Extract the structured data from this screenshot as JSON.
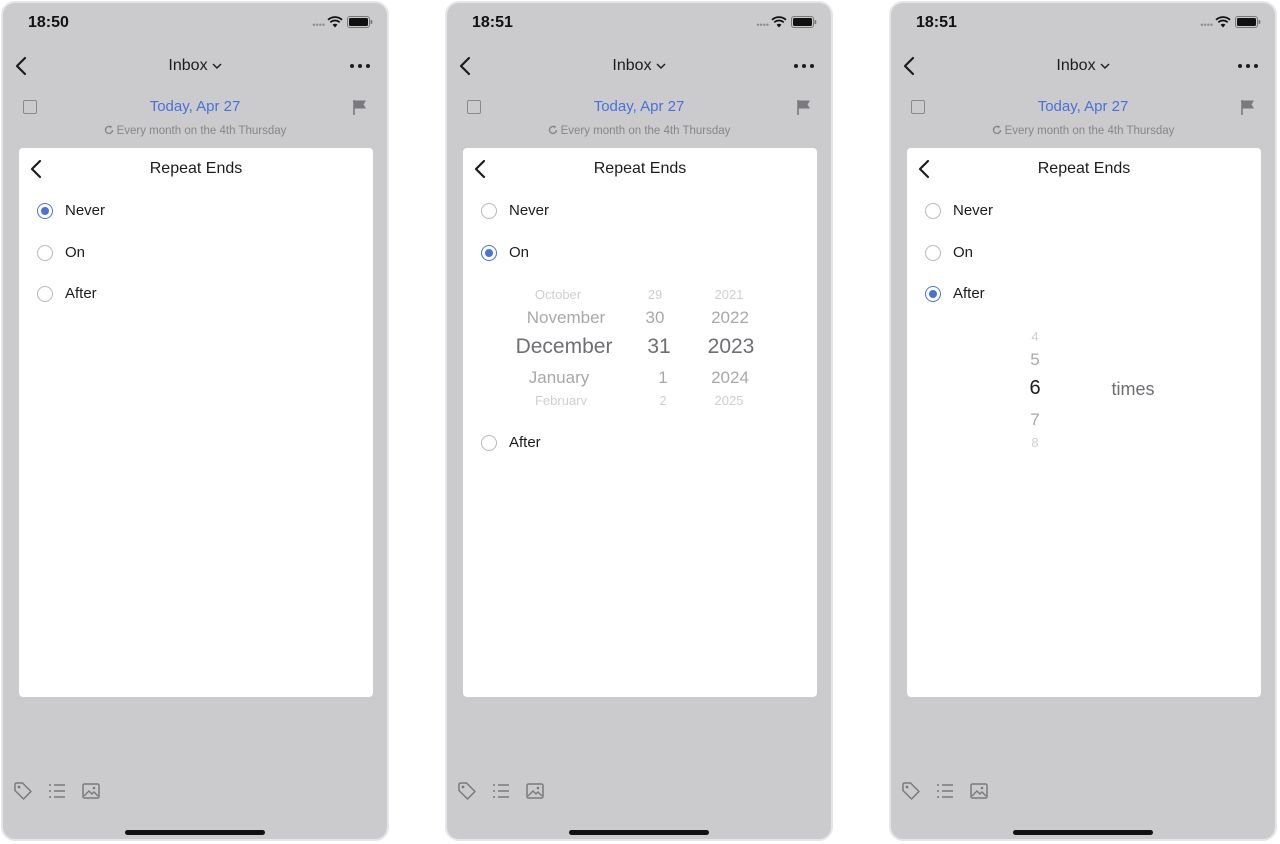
{
  "colors": {
    "accent": "#4a72d9",
    "date_link": "#4772db",
    "screen_bg": "#cbcbcd"
  },
  "screens": [
    {
      "status": {
        "time": "18:50",
        "signal": "••••"
      },
      "nav": {
        "title": "Inbox"
      },
      "task": {
        "date": "Today, Apr 27",
        "repeat": "Every month on the 4th Thursday"
      },
      "panel": {
        "title": "Repeat Ends",
        "options": [
          {
            "label": "Never",
            "selected": true
          },
          {
            "label": "On",
            "selected": false
          },
          {
            "label": "After",
            "selected": false
          }
        ]
      }
    },
    {
      "status": {
        "time": "18:51",
        "signal": "••••"
      },
      "nav": {
        "title": "Inbox"
      },
      "task": {
        "date": "Today, Apr 27",
        "repeat": "Every month on the 4th Thursday"
      },
      "panel": {
        "title": "Repeat Ends",
        "options": [
          {
            "label": "Never",
            "selected": false
          },
          {
            "label": "On",
            "selected": true
          },
          {
            "label": "After",
            "selected": false
          }
        ],
        "date_picker": {
          "months": [
            "October",
            "November",
            "December",
            "January",
            "February"
          ],
          "days": [
            "29",
            "30",
            "31",
            "1",
            "2"
          ],
          "years": [
            "2021",
            "2022",
            "2023",
            "2024",
            "2025"
          ],
          "selected": {
            "month": "December",
            "day": "31",
            "year": "2023"
          }
        }
      }
    },
    {
      "status": {
        "time": "18:51",
        "signal": "••••"
      },
      "nav": {
        "title": "Inbox"
      },
      "task": {
        "date": "Today, Apr 27",
        "repeat": "Every month on the 4th Thursday"
      },
      "panel": {
        "title": "Repeat Ends",
        "options": [
          {
            "label": "Never",
            "selected": false
          },
          {
            "label": "On",
            "selected": false
          },
          {
            "label": "After",
            "selected": true
          }
        ],
        "count_picker": {
          "values": [
            "4",
            "5",
            "6",
            "7",
            "8"
          ],
          "selected": "6",
          "unit": "times"
        }
      }
    }
  ]
}
